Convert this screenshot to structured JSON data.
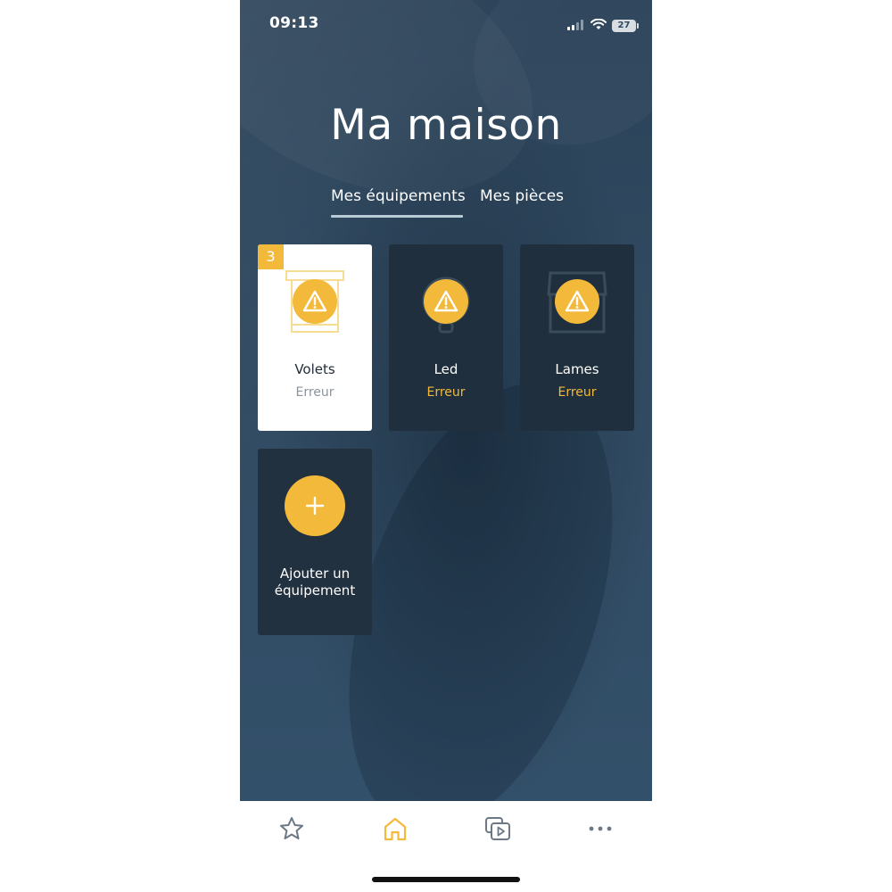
{
  "status_bar": {
    "time": "09:13",
    "battery": "27"
  },
  "page": {
    "title": "Ma maison"
  },
  "tabs": [
    {
      "label": "Mes équipements",
      "active": true
    },
    {
      "label": "Mes pièces",
      "active": false
    }
  ],
  "devices": [
    {
      "name": "Volets",
      "status": "Erreur",
      "badge": "3",
      "icon": "shutter-icon",
      "selected": true
    },
    {
      "name": "Led",
      "status": "Erreur",
      "icon": "bulb-icon",
      "selected": false
    },
    {
      "name": "Lames",
      "status": "Erreur",
      "icon": "pergola-icon",
      "selected": false
    }
  ],
  "add_device": {
    "label_line1": "Ajouter un",
    "label_line2": "équipement"
  },
  "tab_bar": {
    "items": [
      "star-icon",
      "home-icon",
      "media-icon",
      "more-icon"
    ],
    "active": "home-icon"
  },
  "colors": {
    "accent": "#f3b93a",
    "background": "#2f4960",
    "card": "#1f2f3d"
  }
}
